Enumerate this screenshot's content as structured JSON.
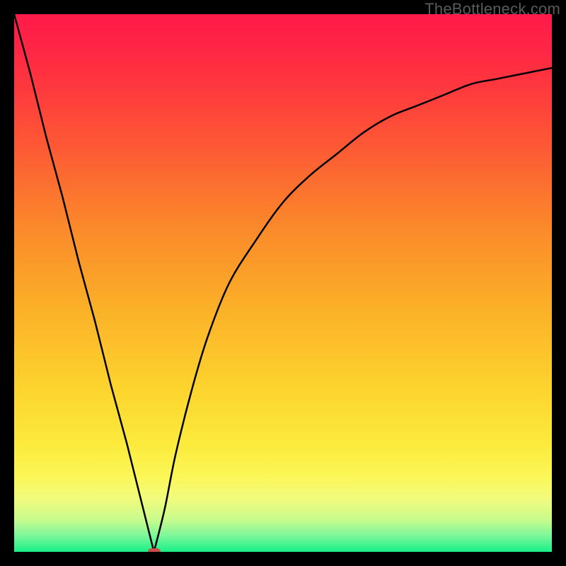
{
  "watermark": "TheBottleneck.com",
  "marker_color": "#c94f4a",
  "gradient_stops": [
    {
      "offset": 0.0,
      "color": "#ff1a4b"
    },
    {
      "offset": 0.1,
      "color": "#ff2e41"
    },
    {
      "offset": 0.25,
      "color": "#fd5a34"
    },
    {
      "offset": 0.4,
      "color": "#fb8a2a"
    },
    {
      "offset": 0.55,
      "color": "#fbb128"
    },
    {
      "offset": 0.7,
      "color": "#fdd52e"
    },
    {
      "offset": 0.8,
      "color": "#fcea3d"
    },
    {
      "offset": 0.86,
      "color": "#fbf757"
    },
    {
      "offset": 0.9,
      "color": "#f2fb7c"
    },
    {
      "offset": 0.94,
      "color": "#c8fb8d"
    },
    {
      "offset": 0.97,
      "color": "#7df79a"
    },
    {
      "offset": 1.0,
      "color": "#19ef88"
    }
  ],
  "chart_data": {
    "type": "line",
    "title": "",
    "xlabel": "",
    "ylabel": "",
    "xlim": [
      0,
      100
    ],
    "ylim": [
      0,
      100
    ],
    "minimum_at_x": 26,
    "series": [
      {
        "name": "curve",
        "x": [
          0,
          3,
          6,
          9,
          12,
          15,
          18,
          21,
          24,
          26,
          28,
          30,
          33,
          36,
          40,
          45,
          50,
          55,
          60,
          65,
          70,
          75,
          80,
          85,
          90,
          95,
          100
        ],
        "values": [
          100,
          89,
          77,
          66,
          54,
          43,
          31,
          20,
          8,
          0,
          8,
          18,
          30,
          40,
          50,
          58,
          65,
          70,
          74,
          78,
          81,
          83,
          85,
          87,
          88,
          89,
          90
        ]
      }
    ],
    "marker": {
      "x": 26,
      "y": 0
    }
  }
}
